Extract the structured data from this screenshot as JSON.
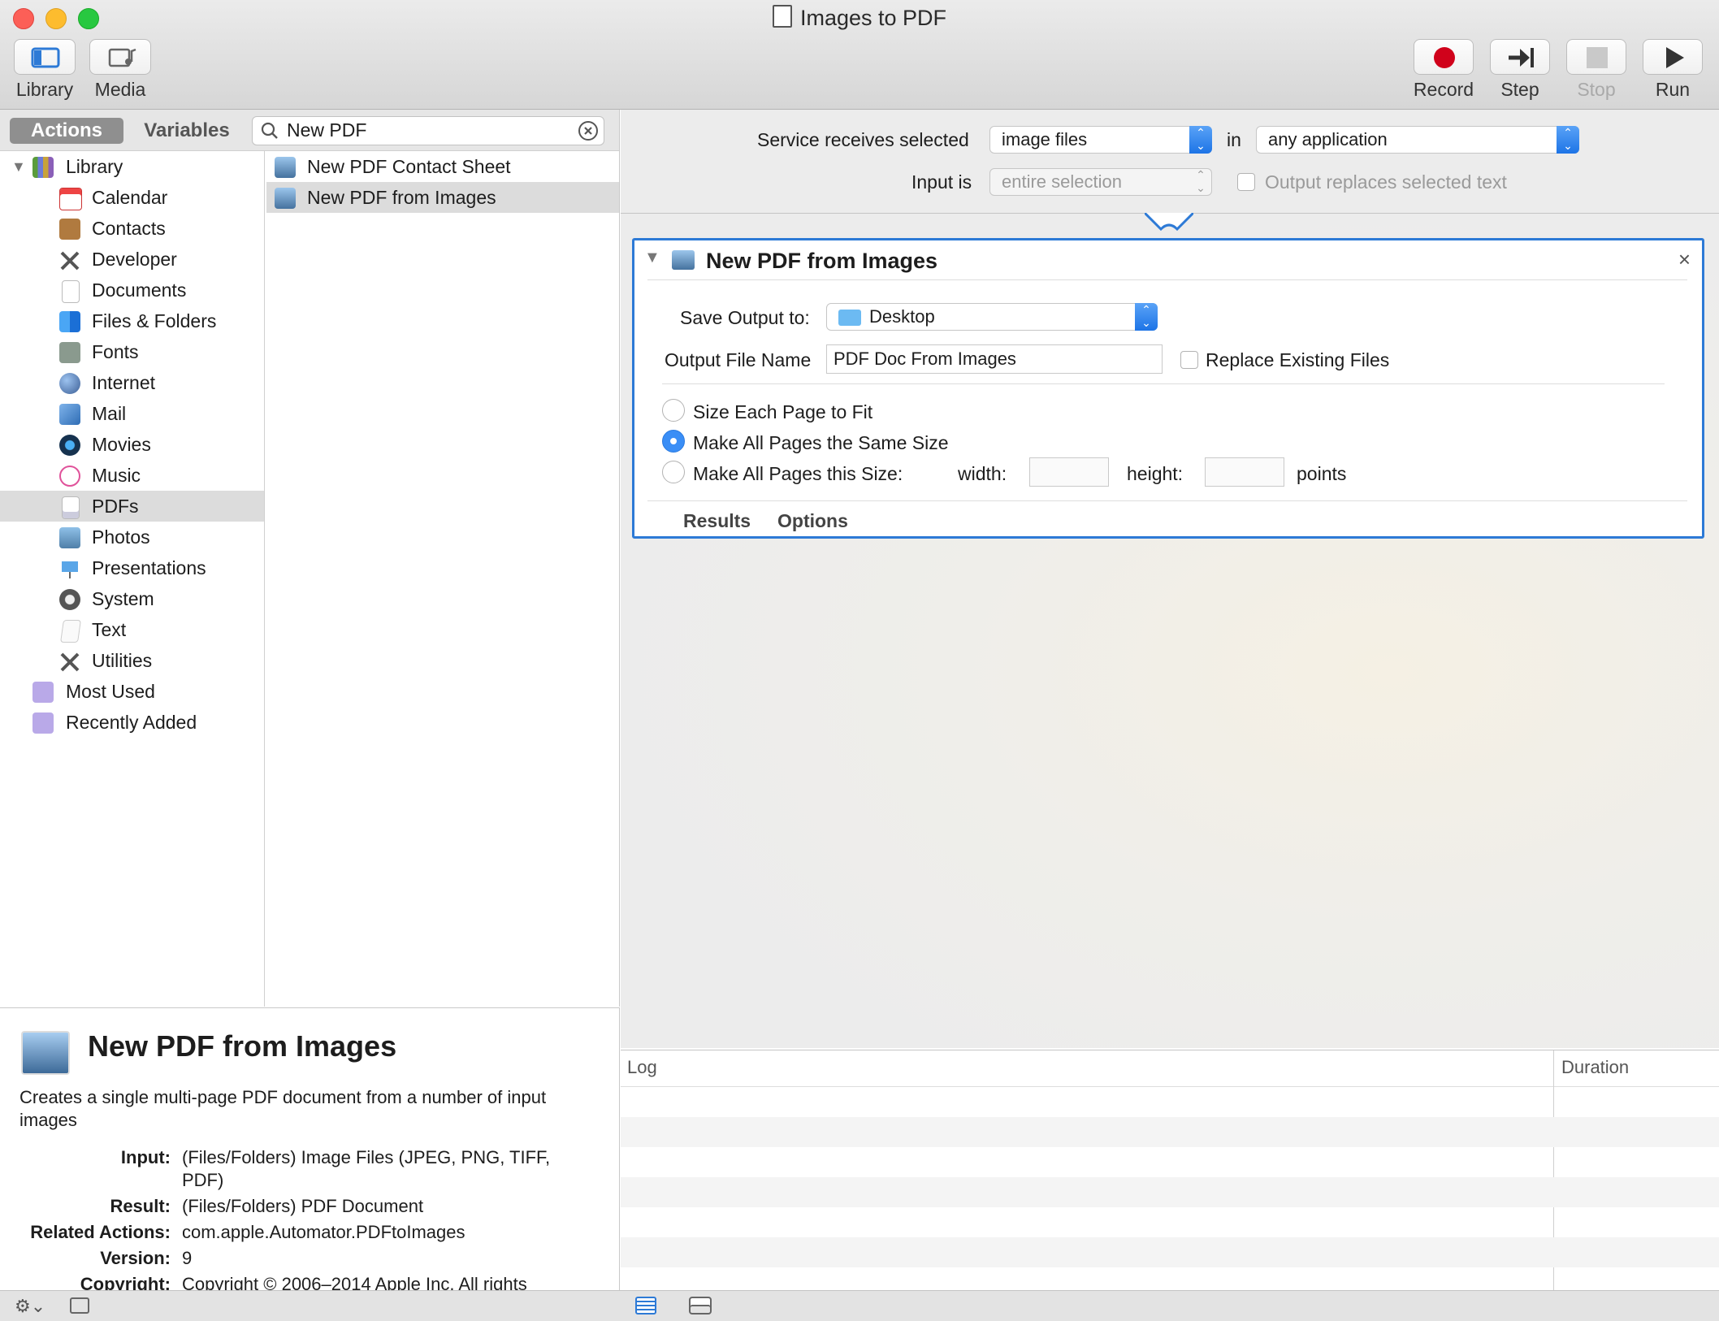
{
  "window": {
    "title": "Images to PDF"
  },
  "toolbar": {
    "library": "Library",
    "media": "Media",
    "record": "Record",
    "step": "Step",
    "stop": "Stop",
    "run": "Run"
  },
  "left": {
    "tabs": {
      "actions": "Actions",
      "variables": "Variables"
    },
    "search_value": "New PDF",
    "library_root": "Library",
    "library_items": [
      "Calendar",
      "Contacts",
      "Developer",
      "Documents",
      "Files & Folders",
      "Fonts",
      "Internet",
      "Mail",
      "Movies",
      "Music",
      "PDFs",
      "Photos",
      "Presentations",
      "System",
      "Text",
      "Utilities"
    ],
    "smart_groups": [
      "Most Used",
      "Recently Added"
    ],
    "actions": [
      "New PDF Contact Sheet",
      "New PDF from Images"
    ]
  },
  "description": {
    "title": "New PDF from Images",
    "summary": "Creates a single multi-page PDF document from a number of input images",
    "input_label": "Input:",
    "input_value": "(Files/Folders) Image Files (JPEG, PNG, TIFF, PDF)",
    "result_label": "Result:",
    "result_value": "(Files/Folders) PDF Document",
    "related_label": "Related Actions:",
    "related_value": "com.apple.Automator.PDFtoImages",
    "version_label": "Version:",
    "version_value": "9",
    "copyright_label": "Copyright:",
    "copyright_value": "Copyright © 2006–2014 Apple Inc. All rights"
  },
  "service": {
    "receives_label": "Service receives selected",
    "receives_value": "image files",
    "in_label": "in",
    "app_value": "any application",
    "input_is_label": "Input is",
    "input_is_value": "entire selection",
    "replaces_label": "Output replaces selected text"
  },
  "action": {
    "title": "New PDF from Images",
    "save_label": "Save Output to:",
    "save_value": "Desktop",
    "filename_label": "Output File Name",
    "filename_value": "PDF Doc From Images",
    "replace_label": "Replace Existing Files",
    "opt_fit": "Size Each Page to Fit",
    "opt_same": "Make All Pages the Same Size",
    "opt_size": "Make All Pages this Size:",
    "width_label": "width:",
    "height_label": "height:",
    "points_label": "points",
    "results_tab": "Results",
    "options_tab": "Options"
  },
  "log": {
    "col_log": "Log",
    "col_duration": "Duration"
  },
  "colors": {
    "accent": "#2d7ad6",
    "record": "#d0021b",
    "selection": "#dcdcdc"
  }
}
